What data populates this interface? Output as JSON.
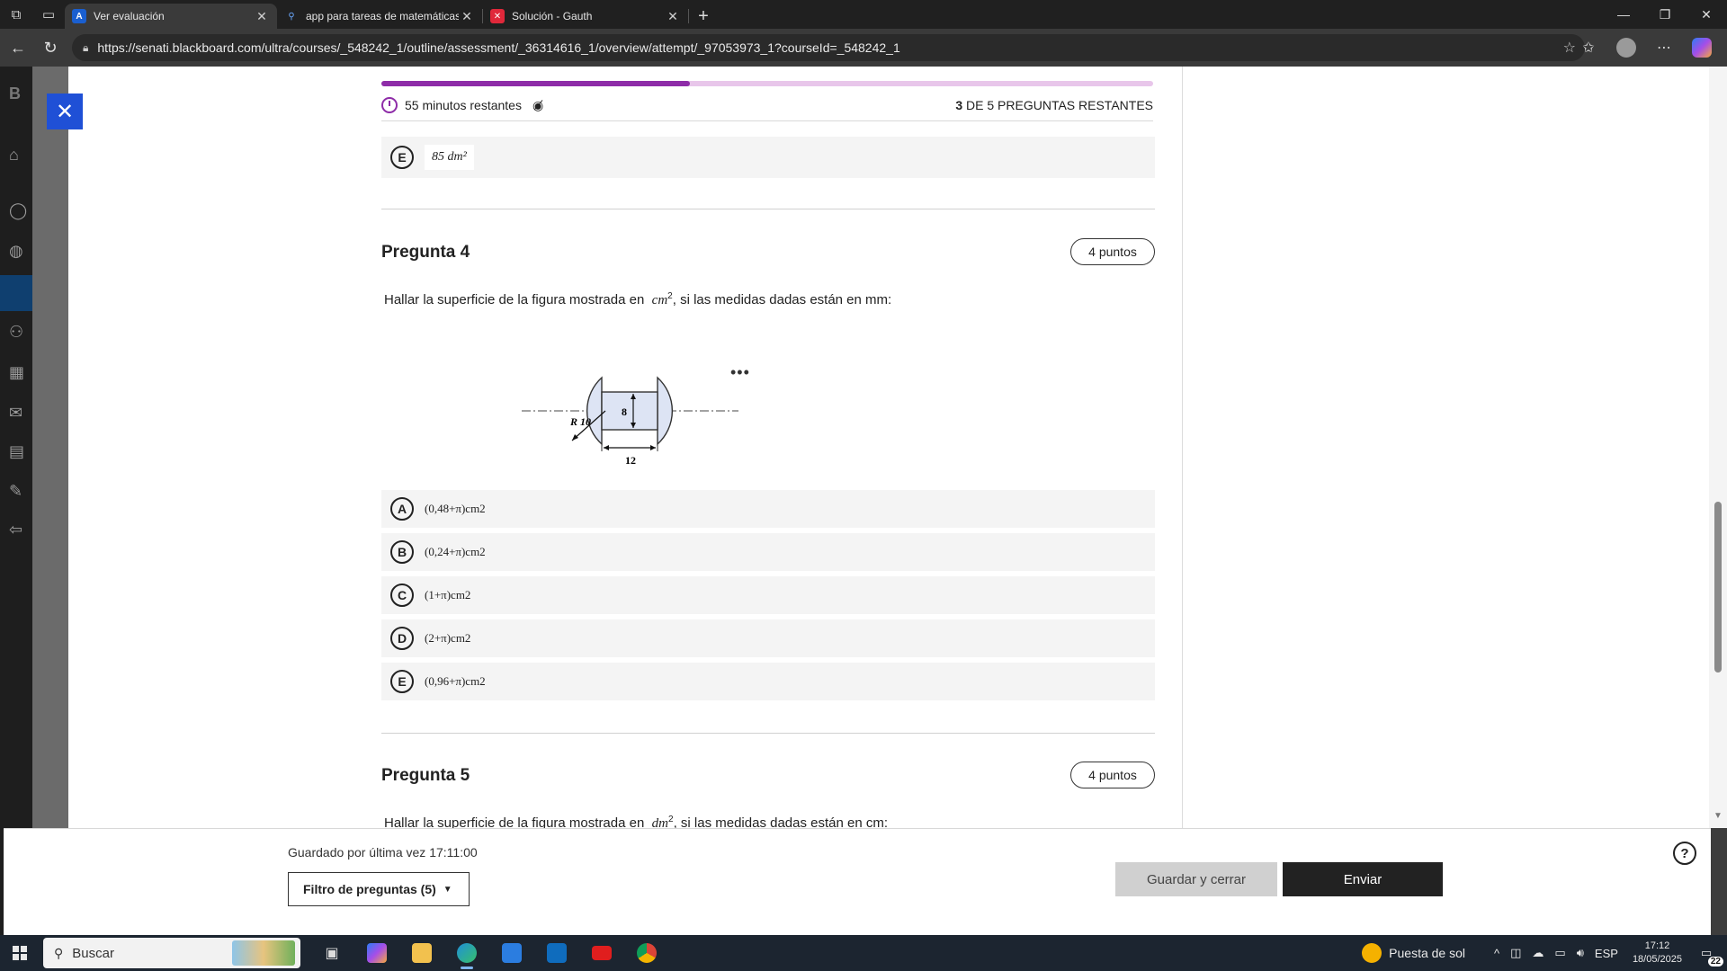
{
  "browser": {
    "tabs": [
      {
        "title": "Ver evaluación",
        "favicon": "blackboard-favicon",
        "favicon_color": "#1a5fd0",
        "active": true
      },
      {
        "title": "app para tareas de matemáticas",
        "favicon": "search-favicon",
        "favicon_color": "#3a3a3a",
        "active": false
      },
      {
        "title": "Solución - Gauth",
        "favicon": "gauth-favicon",
        "favicon_color": "#e0283a",
        "active": false
      }
    ],
    "url": "https://senati.blackboard.com/ultra/courses/_548242_1/outline/assessment/_36314616_1/overview/attempt/_97053973_1?courseId=_548242_1"
  },
  "assessment": {
    "progress": 0.4,
    "time_remaining": "55 minutos restantes",
    "remaining_count": "3",
    "remaining_label": "DE 5 PREGUNTAS RESTANTES",
    "prev_option": {
      "letter": "E",
      "text": "85 dm²"
    },
    "question4": {
      "title": "Pregunta 4",
      "points": "4 puntos",
      "text_before": "Hallar la superficie de la figura mostrada en",
      "unit": "cm",
      "unit_exp": "2",
      "text_after": ", si las medidas dadas están en mm:",
      "figure_labels": {
        "radius": "R 10",
        "height": "8",
        "width": "12"
      },
      "more": "•••",
      "options": [
        {
          "letter": "A",
          "text": "(0,48+π)cm2"
        },
        {
          "letter": "B",
          "text": "(0,24+π)cm2"
        },
        {
          "letter": "C",
          "text": "(1+π)cm2"
        },
        {
          "letter": "D",
          "text": "(2+π)cm2"
        },
        {
          "letter": "E",
          "text": "(0,96+π)cm2"
        }
      ]
    },
    "question5": {
      "title": "Pregunta 5",
      "points": "4 puntos",
      "text_before": "Hallar la superficie de la figura mostrada en",
      "unit": "dm",
      "unit_exp": "2",
      "text_after": ", si las medidas dadas están en cm:"
    }
  },
  "footer": {
    "saved": "Guardado por última vez 17:11:00",
    "filter": "Filtro de preguntas (5)",
    "save_close": "Guardar y cerrar",
    "send": "Enviar"
  },
  "taskbar": {
    "search": "Buscar",
    "weather": "Puesta de sol",
    "lang": "ESP",
    "time": "17:12",
    "date": "18/05/2025",
    "notifications": "22"
  },
  "colors": {
    "accent": "#8e2ca8",
    "progress_bg": "#e8c6ea",
    "close_blue": "#1f50d6"
  }
}
